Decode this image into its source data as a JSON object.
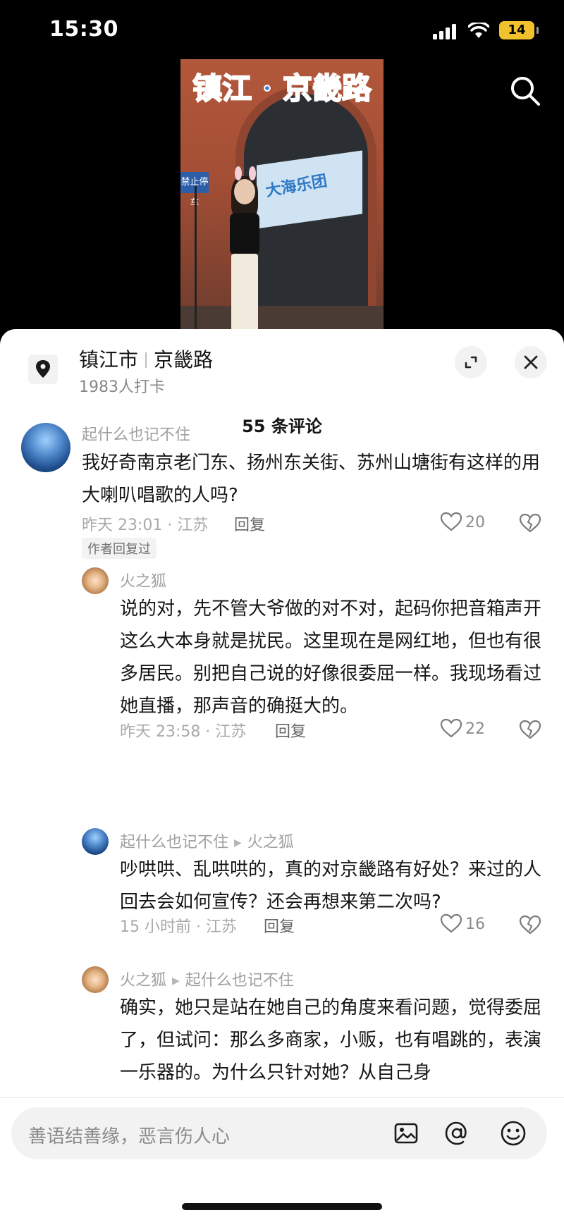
{
  "status_bar": {
    "time": "15:30",
    "battery": "14"
  },
  "video": {
    "overlay_title": "镇江 · 京畿路",
    "banner_text": "大海乐团",
    "sign_text": "禁止停车"
  },
  "location": {
    "name": "镇江市",
    "sub": "京畿路",
    "checkins": "1983人打卡"
  },
  "comments_header": "55 条评论",
  "comments": [
    {
      "user": "起什么也记不住",
      "text": "我好奇南京老门东、扬州东关街、苏州山塘街有这样的用大喇叭唱歌的人吗?",
      "meta": "昨天 23:01 · 江苏",
      "reply": "回复",
      "likes": "20",
      "badge": "作者回复过"
    },
    {
      "user": "火之狐",
      "text": "说的对，先不管大爷做的对不对，起码你把音箱声开这么大本身就是扰民。这里现在是网红地，但也有很多居民。别把自己说的好像很委屈一样。我现场看过她直播，那声音的确挺大的。",
      "meta": "昨天 23:58 · 江苏",
      "reply": "回复",
      "likes": "22"
    },
    {
      "user": "起什么也记不住",
      "reply_to": "火之狐",
      "text": "吵哄哄、乱哄哄的，真的对京畿路有好处？来过的人回去会如何宣传？还会再想来第二次吗?",
      "meta": "15 小时前 · 江苏",
      "reply": "回复",
      "likes": "16"
    },
    {
      "user": "火之狐",
      "reply_to": "起什么也记不住",
      "text": "确实，她只是站在她自己的角度来看问题，觉得委屈了，但试问：那么多商家，小贩，也有唱跳的，表演一乐器的。为什么只针对她？从自己身"
    }
  ],
  "input": {
    "placeholder": "善语结善缘，恶言伤人心"
  },
  "icons": {
    "search": "search-icon",
    "location": "location-pin-icon",
    "expand": "expand-icon",
    "close": "close-icon",
    "like": "heart-icon",
    "dislike": "broken-heart-icon",
    "image": "image-icon",
    "mention": "at-icon",
    "emoji": "emoji-icon"
  }
}
